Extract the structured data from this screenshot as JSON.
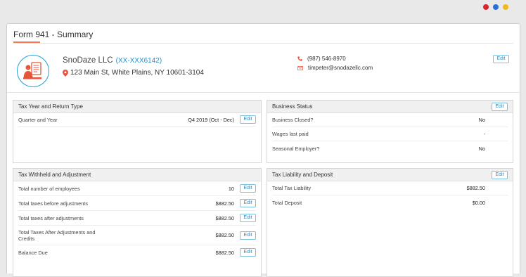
{
  "window": {
    "dots": [
      {
        "name": "red-dot",
        "color": "#d9242d"
      },
      {
        "name": "blue-dot",
        "color": "#2a6fdb"
      },
      {
        "name": "yellow-dot",
        "color": "#f0b81a"
      }
    ]
  },
  "page": {
    "title": "Form 941 - Summary"
  },
  "company": {
    "name": "SnoDaze LLC",
    "ein": "(XX-XXX6142)",
    "address": "123 Main St, White Plains, NY 10601-3104",
    "phone": "(987) 546-8970",
    "email": "timpeter@snodazellc.com",
    "edit_label": "Edit",
    "avatar_icon": "tax-document-person-icon"
  },
  "panels": {
    "tax_year": {
      "title": "Tax Year and Return Type",
      "rows": [
        {
          "label": "Quarter and Year",
          "value": "Q4 2019 (Oct - Dec)",
          "edit": "Edit"
        }
      ]
    },
    "business_status": {
      "title": "Business Status",
      "edit_label": "Edit",
      "rows": [
        {
          "label": "Business Closed?",
          "value": "No"
        },
        {
          "label": "Wages last paid",
          "value": "-"
        },
        {
          "label": "Seasonal Employer?",
          "value": "No"
        }
      ]
    },
    "withheld": {
      "title": "Tax Withheld and Adjustment",
      "rows": [
        {
          "label": "Total number of employees",
          "value": "10",
          "edit": "Edit"
        },
        {
          "label": "Total taxes before adjustments",
          "value": "$882.50",
          "edit": "Edit"
        },
        {
          "label": "Total taxes after adjustments",
          "value": "$882.50",
          "edit": "Edit"
        },
        {
          "label": "Total Taxes After Adjustments and Credits",
          "value": "$882.50",
          "edit": "Edit"
        },
        {
          "label": "Balance Due",
          "value": "$882.50",
          "edit": "Edit"
        }
      ]
    },
    "liability": {
      "title": "Tax Liability and Deposit",
      "edit_label": "Edit",
      "rows": [
        {
          "label": "Total Tax Liability",
          "value": "$882.50"
        },
        {
          "label": "Total Deposit",
          "value": "$0.00"
        }
      ]
    }
  },
  "colors": {
    "accent": "#f07b55",
    "link": "#2a8fc8",
    "avatar_ring": "#2da5d6"
  }
}
